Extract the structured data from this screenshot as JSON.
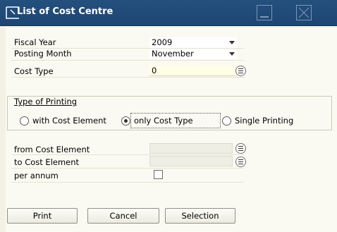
{
  "window": {
    "title": "List of Cost Centre"
  },
  "form": {
    "fiscal_year": {
      "label": "Fiscal Year",
      "value": "2009"
    },
    "posting_month": {
      "label": "Posting Month",
      "value": "November"
    },
    "cost_type": {
      "label": "Cost Type",
      "value": "0"
    },
    "printing": {
      "title": "Type of Printing",
      "options": [
        {
          "label": "with Cost Element",
          "selected": false
        },
        {
          "label": "only Cost Type",
          "selected": true
        },
        {
          "label": "Single Printing",
          "selected": false
        }
      ]
    },
    "from_cost_element": {
      "label": "from Cost Element",
      "value": ""
    },
    "to_cost_element": {
      "label": "to Cost Element",
      "value": ""
    },
    "per_annum": {
      "label": "per annum",
      "checked": false
    }
  },
  "buttons": {
    "print": "Print",
    "cancel": "Cancel",
    "selection": "Selection"
  },
  "icons": {
    "title": "window-icon",
    "lookup": "list-lookup-icon",
    "dropdown": "chevron-down-icon"
  }
}
